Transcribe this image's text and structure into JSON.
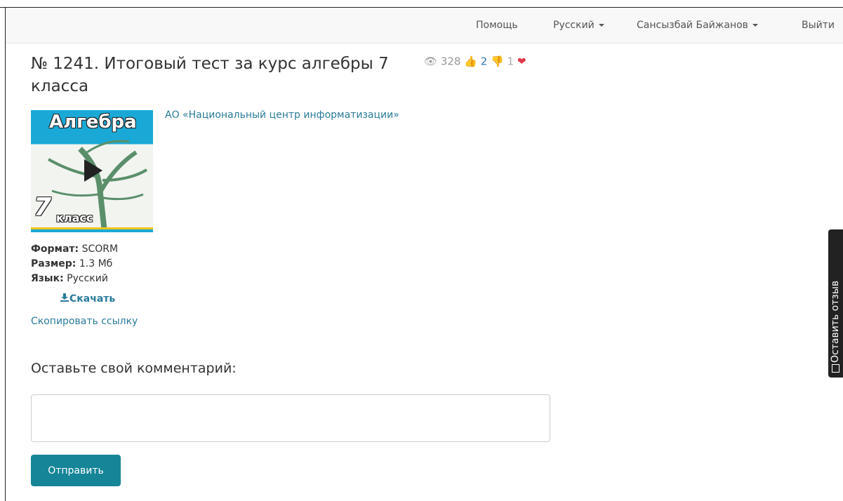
{
  "nav": {
    "help": "Помощь",
    "language": "Русский",
    "user": "Сансызбай Байжанов",
    "logout": "Выйти"
  },
  "resource": {
    "title": "№ 1241. Итоговый тест за курс алгебры 7 класса",
    "views": "328",
    "likes": "2",
    "dislikes": "1",
    "provider": "АО «Национальный центр информатизации»",
    "thumbnail": {
      "title": "Алгебра",
      "grade_number": "7",
      "grade_word": "класс"
    },
    "format_label": "Формат:",
    "format_value": "SCORM",
    "size_label": "Размер:",
    "size_value": "1.3 Мб",
    "language_label": "Язык:",
    "language_value": "Русский",
    "download": "Скачать",
    "copy_link": "Скопировать ссылку"
  },
  "comment": {
    "heading": "Оставьте свой комментарий:",
    "placeholder": "",
    "submit": "Отправить"
  },
  "feedback_tab": "Оставить отзыв",
  "colors": {
    "accent": "#168597",
    "link": "#2a7b9b",
    "like": "#337ab7",
    "heart": "#e0384b"
  }
}
